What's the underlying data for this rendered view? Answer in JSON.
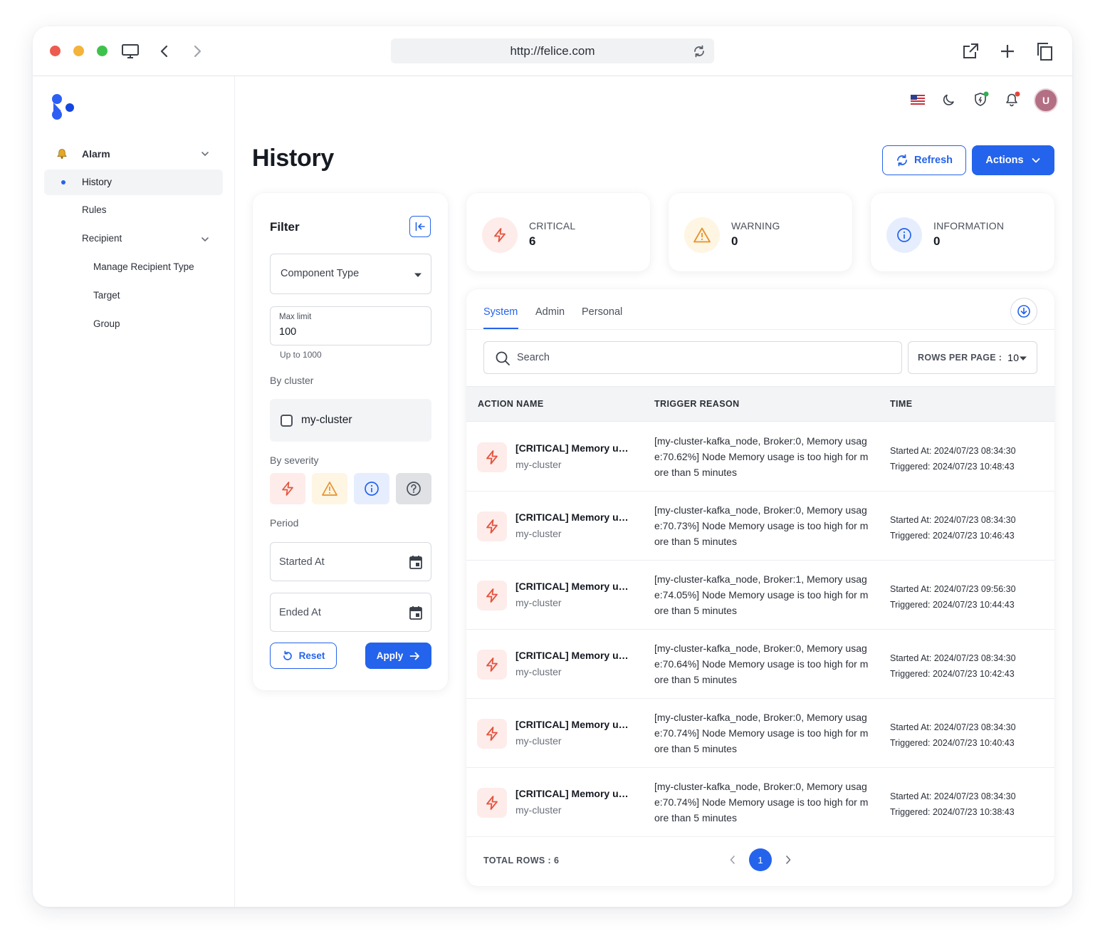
{
  "browser": {
    "url": "http://felice.com"
  },
  "sidebar": {
    "items": [
      {
        "label": "Alarm",
        "level": 0,
        "expandable": true
      },
      {
        "label": "History",
        "level": 1,
        "active": true
      },
      {
        "label": "Rules",
        "level": 1
      },
      {
        "label": "Recipient",
        "level": 1,
        "expandable": true
      },
      {
        "label": "Manage Recipient Type",
        "level": 2
      },
      {
        "label": "Target",
        "level": 2
      },
      {
        "label": "Group",
        "level": 2
      }
    ]
  },
  "header": {
    "avatar_letter": "U",
    "title": "History",
    "refresh_label": "Refresh",
    "actions_label": "Actions"
  },
  "filter": {
    "title": "Filter",
    "component_type_placeholder": "Component Type",
    "max_limit_label": "Max limit",
    "max_limit_value": "100",
    "max_limit_hint": "Up to 1000",
    "by_cluster_label": "By cluster",
    "cluster_option": "my-cluster",
    "by_severity_label": "By severity",
    "period_label": "Period",
    "started_at_placeholder": "Started At",
    "ended_at_placeholder": "Ended At",
    "reset_label": "Reset",
    "apply_label": "Apply"
  },
  "stats": [
    {
      "label": "CRITICAL",
      "value": "6",
      "color": "#e5533d"
    },
    {
      "label": "WARNING",
      "value": "0",
      "color": "#e8912a"
    },
    {
      "label": "INFORMATION",
      "value": "0",
      "color": "#2563eb"
    }
  ],
  "table": {
    "tabs": [
      "System",
      "Admin",
      "Personal"
    ],
    "active_tab": "System",
    "search_placeholder": "Search",
    "rows_per_page_label": "ROWS PER PAGE :",
    "rows_per_page_value": "10",
    "columns": [
      "ACTION NAME",
      "TRIGGER REASON",
      "TIME"
    ],
    "rows": [
      {
        "name": "[CRITICAL] Memory usage",
        "cluster": "my-cluster",
        "reason": "[my-cluster-kafka_node, Broker:0, Memory usage:70.62%] Node Memory usage is too high for more than 5 minutes",
        "started": "Started At: 2024/07/23 08:34:30",
        "triggered": "Triggered: 2024/07/23 10:48:43"
      },
      {
        "name": "[CRITICAL] Memory usage",
        "cluster": "my-cluster",
        "reason": "[my-cluster-kafka_node, Broker:0, Memory usage:70.73%] Node Memory usage is too high for more than 5 minutes",
        "started": "Started At: 2024/07/23 08:34:30",
        "triggered": "Triggered: 2024/07/23 10:46:43"
      },
      {
        "name": "[CRITICAL] Memory usage",
        "cluster": "my-cluster",
        "reason": "[my-cluster-kafka_node, Broker:1, Memory usage:74.05%] Node Memory usage is too high for more than 5 minutes",
        "started": "Started At: 2024/07/23 09:56:30",
        "triggered": "Triggered: 2024/07/23 10:44:43"
      },
      {
        "name": "[CRITICAL] Memory usage",
        "cluster": "my-cluster",
        "reason": "[my-cluster-kafka_node, Broker:0, Memory usage:70.64%] Node Memory usage is too high for more than 5 minutes",
        "started": "Started At: 2024/07/23 08:34:30",
        "triggered": "Triggered: 2024/07/23 10:42:43"
      },
      {
        "name": "[CRITICAL] Memory usage",
        "cluster": "my-cluster",
        "reason": "[my-cluster-kafka_node, Broker:0, Memory usage:70.74%] Node Memory usage is too high for more than 5 minutes",
        "started": "Started At: 2024/07/23 08:34:30",
        "triggered": "Triggered: 2024/07/23 10:40:43"
      },
      {
        "name": "[CRITICAL] Memory usage",
        "cluster": "my-cluster",
        "reason": "[my-cluster-kafka_node, Broker:0, Memory usage:70.74%] Node Memory usage is too high for more than 5 minutes",
        "started": "Started At: 2024/07/23 08:34:30",
        "triggered": "Triggered: 2024/07/23 10:38:43"
      }
    ],
    "total_rows_label": "TOTAL ROWS : 6",
    "current_page": "1"
  },
  "colors": {
    "accent": "#2463eb",
    "critical": "#e5533d",
    "warning": "#e8912a",
    "info": "#2563eb"
  }
}
